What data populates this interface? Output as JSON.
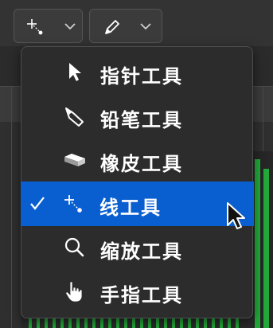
{
  "toolbar": {
    "left_tool": {
      "icon": "line-tool-icon",
      "chevron": "chevron-down-icon"
    },
    "right_tool": {
      "icon": "pencil-icon",
      "chevron": "chevron-down-icon"
    }
  },
  "tool_menu": {
    "items": [
      {
        "label": "指针工具",
        "icon": "pointer-arrow-icon",
        "selected": false
      },
      {
        "label": "铅笔工具",
        "icon": "pencil-icon",
        "selected": false
      },
      {
        "label": "橡皮工具",
        "icon": "eraser-icon",
        "selected": false
      },
      {
        "label": "线工具",
        "icon": "line-tool-icon",
        "selected": true
      },
      {
        "label": "缩放工具",
        "icon": "magnifier-icon",
        "selected": false
      },
      {
        "label": "手指工具",
        "icon": "hand-finger-icon",
        "selected": false
      }
    ]
  },
  "colors": {
    "selection": "#0a5fd0",
    "menu_background": "#2c2c2c",
    "meter_green": "#22a93a",
    "text": "#ffffff"
  }
}
